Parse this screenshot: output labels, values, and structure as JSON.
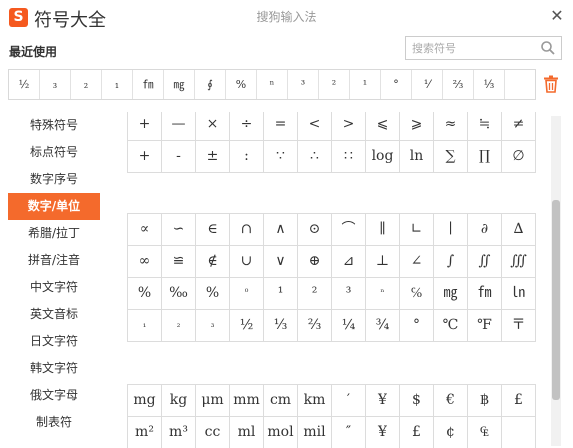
{
  "app": {
    "logo_letter": "S",
    "title": "符号大全",
    "window_title": "搜狗输入法",
    "close_label": "✕"
  },
  "recent": {
    "label": "最近使用",
    "symbols": [
      "½",
      "₃",
      "₂",
      "₁",
      "㎙",
      "㎎",
      "∮",
      "%",
      "ⁿ",
      "³",
      "²",
      "¹",
      "°",
      "⅟",
      "⅔",
      "⅓",
      ""
    ]
  },
  "search": {
    "placeholder": "搜索符号"
  },
  "sidebar": {
    "active_index": 3,
    "items": [
      "特殊符号",
      "标点符号",
      "数字序号",
      "数字/单位",
      "希腊/拉丁",
      "拼音/注音",
      "中文字符",
      "英文音标",
      "日文字符",
      "韩文字符",
      "俄文字母",
      "制表符"
    ]
  },
  "grids": {
    "section1": [
      "+",
      "—",
      "×",
      "÷",
      "=",
      "<",
      ">",
      "⩽",
      "⩾",
      "≈",
      "≒",
      "≠",
      "+",
      "-",
      "±",
      ":",
      "∵",
      "∴",
      "∷",
      "log",
      "ln",
      "∑",
      "∏",
      "∅"
    ],
    "section2": [
      "∝",
      "∽",
      "∈",
      "∩",
      "∧",
      "⊙",
      "⌒",
      "∥",
      "∟",
      "∣",
      "∂",
      "∆",
      "∞",
      "≌",
      "∉",
      "∪",
      "∨",
      "⊕",
      "⊿",
      "⊥",
      "∠",
      "∫",
      "∬",
      "∭",
      "%",
      "‰",
      "%",
      "⁰",
      "¹",
      "²",
      "³",
      "ⁿ",
      "℅",
      "㎎",
      "㎙",
      "㏑",
      "₁",
      "₂",
      "₃",
      "½",
      "⅓",
      "⅔",
      "¼",
      "¾",
      "°",
      "℃",
      "℉",
      "〒"
    ],
    "section3": [
      "mg",
      "kg",
      "μm",
      "mm",
      "cm",
      "km",
      "′",
      "¥",
      "$",
      "€",
      "฿",
      "£",
      "m²",
      "m³",
      "cc",
      "ml",
      "mol",
      "mil",
      "″",
      "¥",
      "£",
      "¢",
      "₠",
      ""
    ]
  },
  "colors": {
    "accent": "#f46a2c",
    "logo": "#f5591f"
  }
}
